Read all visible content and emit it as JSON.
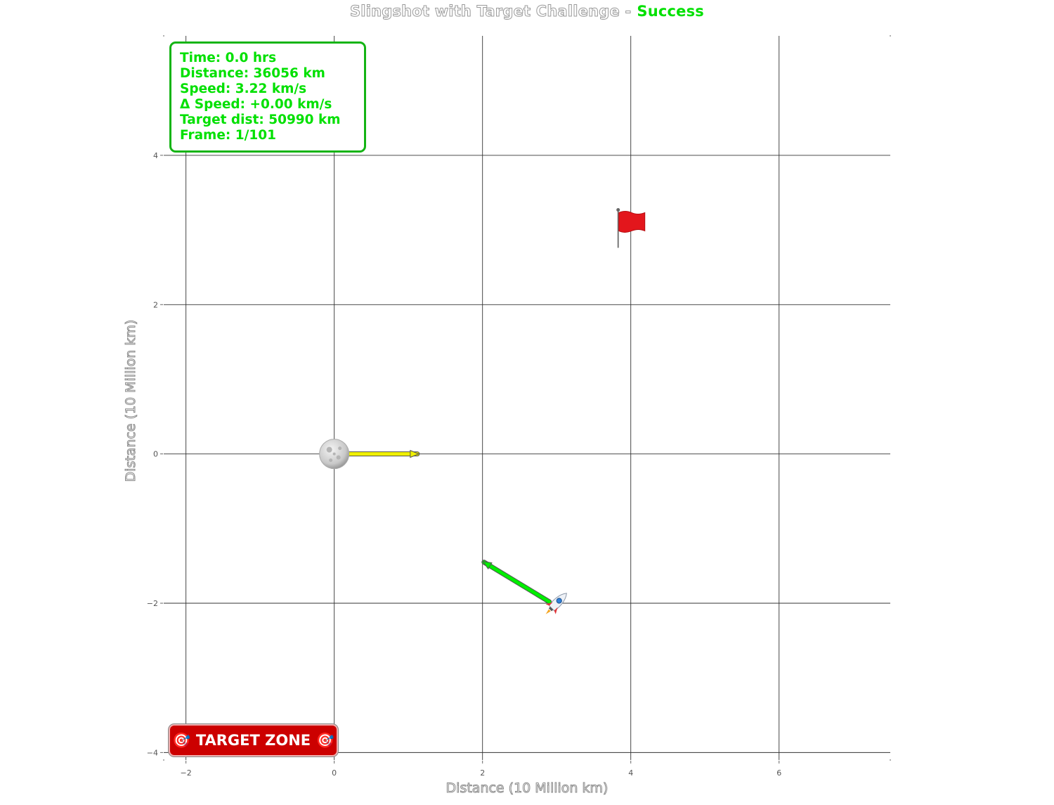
{
  "title": {
    "main": "Slingshot with Target Challenge -",
    "status": "Success",
    "status_color": "#00e000"
  },
  "info": {
    "time": "Time: 0.0 hrs",
    "distance": "Distance: 36056 km",
    "speed": "Speed: 3.22 km/s",
    "delta_speed": "Δ Speed: +0.00 km/s",
    "target_dist": "Target dist: 50990 km",
    "frame": "Frame: 1/101"
  },
  "target_zone_label": "🎯 TARGET ZONE 🎯",
  "chart_data": {
    "type": "scatter",
    "xlabel": "Distance (10 Million km)",
    "ylabel": "Distance (10 Million km)",
    "xlim": [
      -2.3,
      7.5
    ],
    "ylim": [
      -4.1,
      5.6
    ],
    "x_ticks": [
      -2,
      0,
      2,
      4,
      6
    ],
    "y_ticks": [
      -4,
      -2,
      0,
      2,
      4
    ],
    "x_tick_labels": [
      "−2",
      "0",
      "2",
      "4",
      "6"
    ],
    "y_tick_labels": [
      "−4",
      "−2",
      "0",
      "2",
      "4"
    ],
    "grid": true,
    "objects": [
      {
        "kind": "moon",
        "icon": "moon-icon",
        "x": 0,
        "y": 0
      },
      {
        "kind": "spacecraft",
        "icon": "rocket-icon",
        "x": 3.0,
        "y": -2.0
      },
      {
        "kind": "target",
        "icon": "red-flag-icon",
        "x": 4.0,
        "y": 3.1
      }
    ],
    "vectors": [
      {
        "name": "moon-velocity",
        "from": [
          0.15,
          0
        ],
        "to": [
          1.12,
          0
        ],
        "color": "#f0f000"
      },
      {
        "name": "spacecraft-velocity",
        "from": [
          2.9,
          -1.98
        ],
        "to": [
          2.02,
          -1.45
        ],
        "color": "#00ee00"
      }
    ]
  }
}
